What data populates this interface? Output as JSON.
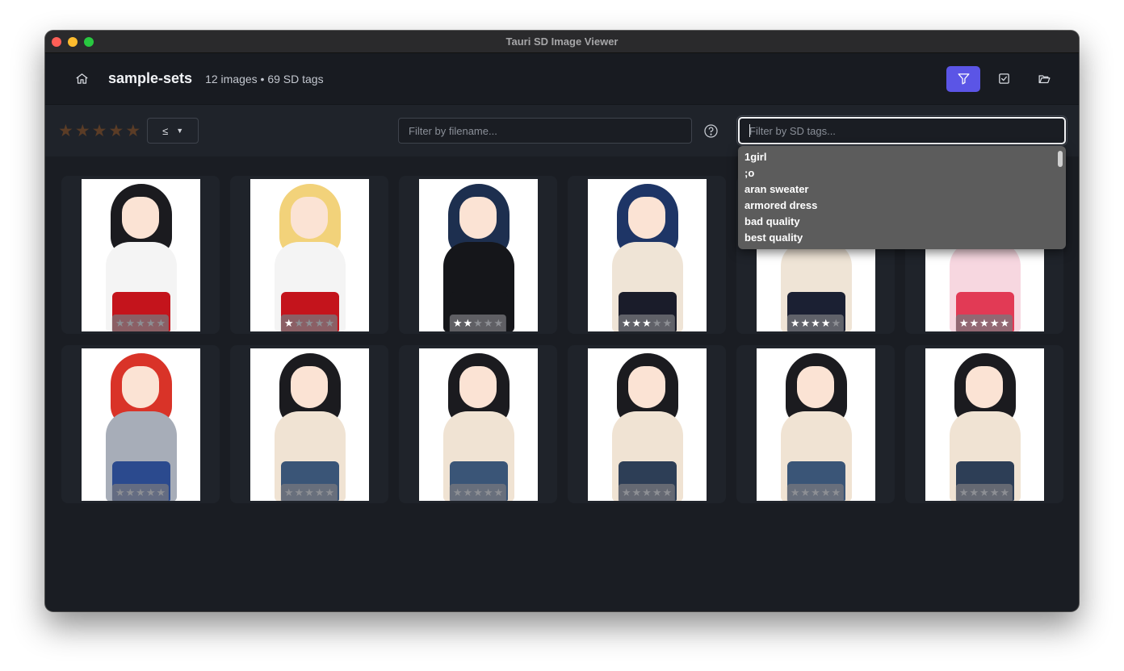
{
  "window": {
    "title": "Tauri SD Image Viewer"
  },
  "header": {
    "folder_name": "sample-sets",
    "meta": "12 images • 69 SD tags",
    "home_icon": "home-icon",
    "actions": [
      {
        "name": "filter-icon",
        "active": true
      },
      {
        "name": "checkbox-icon",
        "active": false
      },
      {
        "name": "folder-open-icon",
        "active": false
      }
    ]
  },
  "toolbar": {
    "rating_stars": [
      "★",
      "★",
      "★",
      "★",
      "★"
    ],
    "compare_operator": "≤",
    "filename_placeholder": "Filter by filename...",
    "tags_placeholder": "Filter by SD tags..."
  },
  "tag_suggestions": [
    "1girl",
    ";o",
    "aran sweater",
    "armored dress",
    "bad quality",
    "best quality"
  ],
  "images": [
    {
      "rating": 0,
      "hair": "#1b1b1f",
      "top": "#f4f4f4",
      "bottom": "#c4141c"
    },
    {
      "rating": 1,
      "hair": "#f2d27a",
      "top": "#f4f4f4",
      "bottom": "#c4141c"
    },
    {
      "rating": 2,
      "hair": "#1d2f4f",
      "top": "#15161a",
      "bottom": "#15161a"
    },
    {
      "rating": 3,
      "hair": "#1e3566",
      "top": "#efe4d6",
      "bottom": "#1a1c2a"
    },
    {
      "rating": 4,
      "hair": "#2a4f8a",
      "top": "#efe4d6",
      "bottom": "#1b2033"
    },
    {
      "rating": 5,
      "hair": "#f3c6c9",
      "top": "#f7d7e0",
      "bottom": "#e23a55"
    },
    {
      "rating": 0,
      "hair": "#d93328",
      "top": "#a7adb8",
      "bottom": "#2b4a8e"
    },
    {
      "rating": 0,
      "hair": "#1b1b1f",
      "top": "#f0e3d3",
      "bottom": "#3a5577"
    },
    {
      "rating": 0,
      "hair": "#1b1b1f",
      "top": "#f0e3d3",
      "bottom": "#3a5577"
    },
    {
      "rating": 0,
      "hair": "#1b1b1f",
      "top": "#f0e3d3",
      "bottom": "#2d3e56"
    },
    {
      "rating": 0,
      "hair": "#1b1b1f",
      "top": "#f0e3d3",
      "bottom": "#3a5577"
    },
    {
      "rating": 0,
      "hair": "#1b1b1f",
      "top": "#f0e3d3",
      "bottom": "#2d3e56"
    }
  ]
}
